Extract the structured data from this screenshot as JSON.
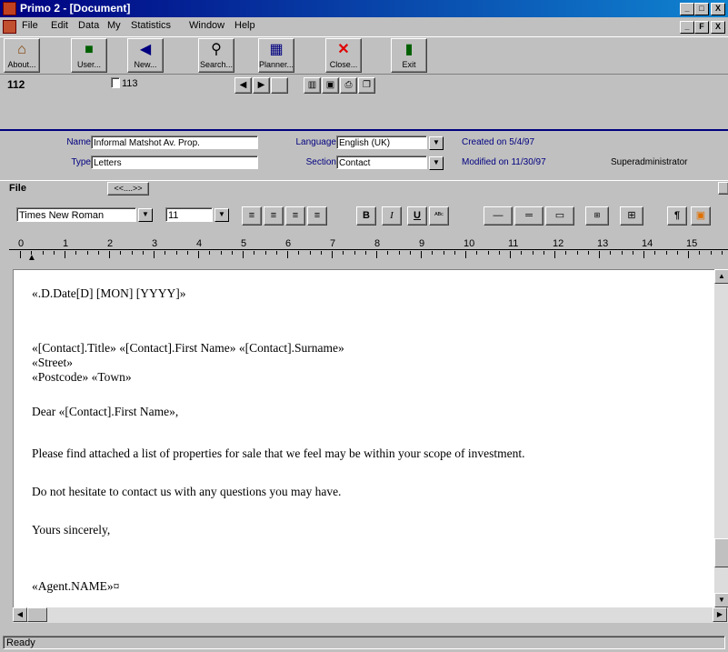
{
  "window": {
    "title": "Primo 2 - [Document]",
    "title_controls": [
      "_",
      "□",
      "X"
    ],
    "child_controls": [
      "_",
      "F",
      "X"
    ]
  },
  "menu": [
    "File",
    "Edit",
    "Data",
    "My",
    "Statistics",
    "Window",
    "Help"
  ],
  "toolbar": [
    {
      "label": "About...",
      "icon": "home-icon"
    },
    {
      "label": "User...",
      "icon": "user-book-icon"
    },
    {
      "label": "New...",
      "icon": "new-arrow-icon"
    },
    {
      "label": "Search...",
      "icon": "search-icon"
    },
    {
      "label": "Planner...",
      "icon": "planner-icon"
    },
    {
      "label": "Close...",
      "icon": "close-icon"
    },
    {
      "label": "Exit",
      "icon": "exit-icon"
    }
  ],
  "record": {
    "id": "112",
    "ref": "113"
  },
  "info": {
    "name_label": "Name",
    "name_value": "Informal Matshot Av. Prop.",
    "type_label": "Type",
    "type_value": "Letters",
    "language_label": "Language",
    "language_value": "English (UK)",
    "section_label": "Section",
    "section_value": "Contact",
    "created": "Created on 5/4/97",
    "modified": "Modified on 11/30/97",
    "author": "Superadministrator"
  },
  "filebar": {
    "label": "File",
    "button": "<<....>>"
  },
  "format": {
    "font": "Times New Roman",
    "size": "11"
  },
  "ruler": [
    "0",
    "1",
    "2",
    "3",
    "4",
    "5",
    "6",
    "7",
    "8",
    "9",
    "10",
    "11",
    "12",
    "13",
    "14",
    "15"
  ],
  "document": [
    "«.D.Date[D] [MON] [YYYY]»",
    "«[Contact].Title» «[Contact].First Name» «[Contact].Surname»",
    "«Street»",
    "«Postcode» «Town»",
    "Dear «[Contact].First Name»,",
    "Please find attached a list of properties for sale that we feel may be within your scope of investment.",
    "Do not hesitate to contact us with any questions you may have.",
    "Yours sincerely,",
    "«Agent.NAME»¤"
  ],
  "status": "Ready"
}
